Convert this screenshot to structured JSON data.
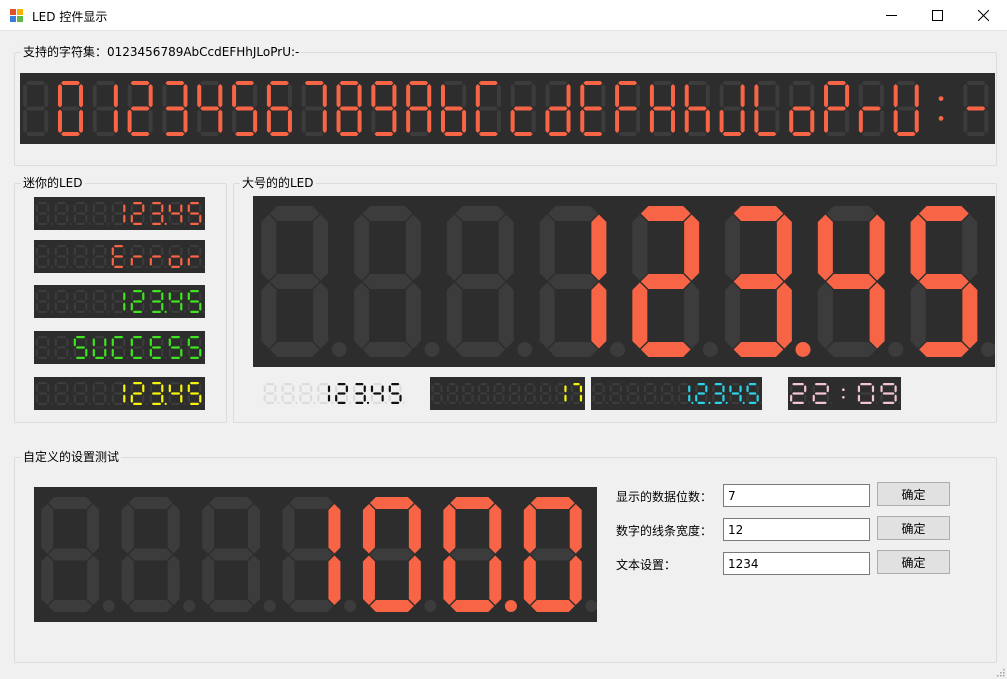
{
  "window": {
    "title": "LED 控件显示"
  },
  "colors": {
    "led_bg": "#2d2d2d",
    "off_segment": "#3c3c3c",
    "red": "#f76446",
    "green": "#3fe31f",
    "yellow": "#f5f50b",
    "cyan": "#2ad3e8",
    "pink": "#f3c5d2",
    "black_text": "#111111",
    "white_bg": "#f0f0f0"
  },
  "charset_group": {
    "label": "支持的字符集：0123456789AbCcdEFHhJLoPrU:-",
    "display": "0123456789AbCcdEFHhJLoPrU:-"
  },
  "mini_group": {
    "label": "迷你的LED",
    "displays": [
      {
        "text": "123.45",
        "digits": 9,
        "color": "red"
      },
      {
        "text": "Error",
        "digits": 9,
        "color": "red"
      },
      {
        "text": "123.45",
        "digits": 9,
        "color": "green"
      },
      {
        "text": "SUCCESS",
        "digits": 9,
        "color": "green"
      },
      {
        "text": "123.45",
        "digits": 9,
        "color": "yellow"
      }
    ]
  },
  "large_group": {
    "label": "大号的的LED",
    "main_display": {
      "text": "123.45",
      "digits": 8,
      "color": "red"
    },
    "small_displays": [
      {
        "text": "123.45",
        "digits": 8,
        "color": "black"
      },
      {
        "text": "17",
        "digits": 10,
        "color": "yellow"
      },
      {
        "text": "1.2.3.4.5",
        "digits": 10,
        "color": "cyan"
      },
      {
        "text": "22:09",
        "digits": 5,
        "color": "pink"
      }
    ]
  },
  "custom_group": {
    "label": "自定义的设置测试",
    "display": {
      "text": "100.0",
      "digits": 7,
      "color": "red"
    },
    "settings": [
      {
        "label": "显示的数据位数：",
        "value": "7",
        "button": "确定"
      },
      {
        "label": "数字的线条宽度：",
        "value": "12",
        "button": "确定"
      },
      {
        "label": "文本设置：",
        "value": "1234",
        "button": "确定"
      }
    ]
  }
}
